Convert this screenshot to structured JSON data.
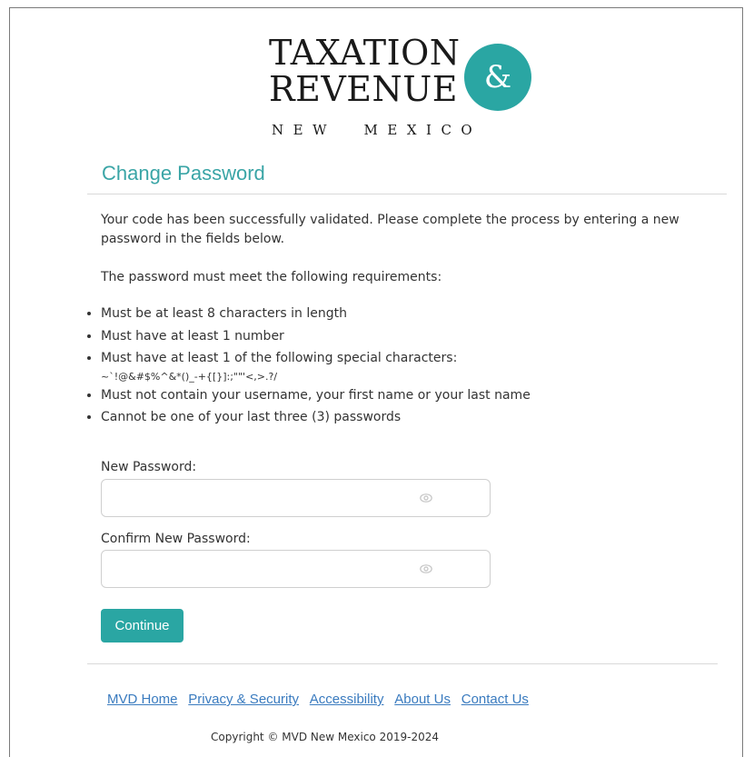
{
  "logo": {
    "line1": "TAXATION",
    "line2": "REVENUE",
    "amp": "&",
    "state": "NEW  MEXICO"
  },
  "page": {
    "title": "Change Password"
  },
  "intro": {
    "text": "Your code has been successfully validated. Please complete the process by entering a new password in the fields below.",
    "requirements_heading": "The password must meet the following requirements:"
  },
  "requirements": {
    "r1": "Must be at least 8 characters in length",
    "r2": "Must have at least 1 number",
    "r3": "Must have at least 1 of the following special characters:",
    "r3_chars": "~`!@&#$%^&*()_-+{[}]:;\"\"'<,>.?/",
    "r4": "Must not contain your username, your first name or your last name",
    "r5": "Cannot be one of your last three (3) passwords"
  },
  "form": {
    "new_password_label": "New Password:",
    "new_password_value": "",
    "confirm_password_label": "Confirm New Password:",
    "confirm_password_value": "",
    "continue_label": "Continue"
  },
  "footer": {
    "links": {
      "mvd_home": "MVD Home",
      "privacy": "Privacy & Security",
      "accessibility": "Accessibility",
      "about": "About Us",
      "contact": "Contact Us"
    },
    "copyright": "Copyright © MVD New Mexico 2019-2024"
  },
  "colors": {
    "accent": "#2aa6a3",
    "link": "#3a7bbf"
  }
}
